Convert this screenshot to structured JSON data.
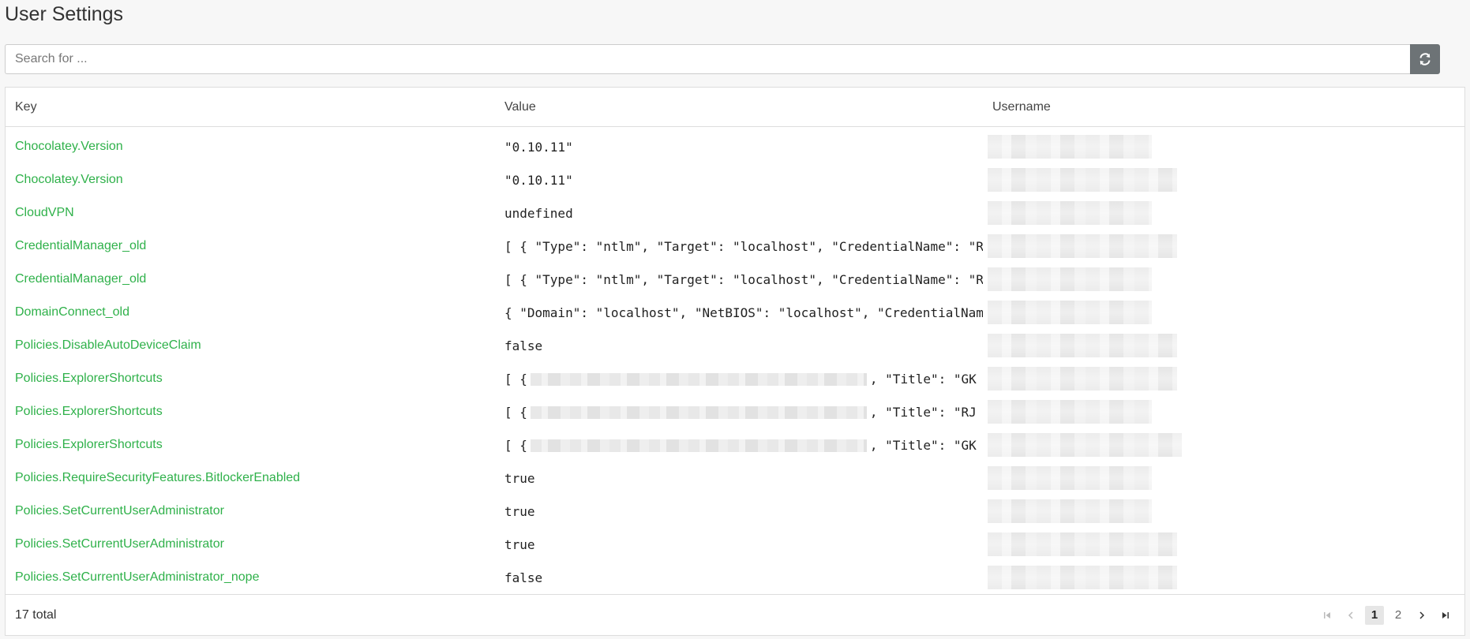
{
  "page": {
    "title": "User Settings"
  },
  "search": {
    "placeholder": "Search for ..."
  },
  "toolbar": {
    "refresh_icon": "refresh-icon"
  },
  "table": {
    "columns": [
      "Key",
      "Value",
      "Username"
    ],
    "rows": [
      {
        "key": "Chocolatey.Version",
        "value": "\"0.10.11\"",
        "value_suffix": ""
      },
      {
        "key": "Chocolatey.Version",
        "value": "\"0.10.11\"",
        "value_suffix": ""
      },
      {
        "key": "CloudVPN",
        "value": "undefined",
        "value_suffix": ""
      },
      {
        "key": "CredentialManager_old",
        "value": "[ { \"Type\": \"ntlm\", \"Target\": \"localhost\", \"CredentialName\": \"R",
        "value_suffix": ""
      },
      {
        "key": "CredentialManager_old",
        "value": "[ { \"Type\": \"ntlm\", \"Target\": \"localhost\", \"CredentialName\": \"R",
        "value_suffix": ""
      },
      {
        "key": "DomainConnect_old",
        "value": "{ \"Domain\": \"localhost\", \"NetBIOS\": \"localhost\", \"CredentialNam",
        "value_suffix": ""
      },
      {
        "key": "Policies.DisableAutoDeviceClaim",
        "value": "false",
        "value_suffix": ""
      },
      {
        "key": "Policies.ExplorerShortcuts",
        "value": "[ {",
        "value_suffix": ", \"Title\": \"GK"
      },
      {
        "key": "Policies.ExplorerShortcuts",
        "value": "[ {",
        "value_suffix": ", \"Title\": \"RJ"
      },
      {
        "key": "Policies.ExplorerShortcuts",
        "value": "[ {",
        "value_suffix": ", \"Title\": \"GK"
      },
      {
        "key": "Policies.RequireSecurityFeatures.BitlockerEnabled",
        "value": "true",
        "value_suffix": ""
      },
      {
        "key": "Policies.SetCurrentUserAdministrator",
        "value": "true",
        "value_suffix": ""
      },
      {
        "key": "Policies.SetCurrentUserAdministrator",
        "value": "true",
        "value_suffix": ""
      },
      {
        "key": "Policies.SetCurrentUserAdministrator_nope",
        "value": "false",
        "value_suffix": ""
      }
    ]
  },
  "footer": {
    "total": "17 total",
    "pages": [
      "1",
      "2"
    ],
    "current_page": "1"
  },
  "colors": {
    "link": "#2fb14a",
    "refresh_button": "#6d7376"
  }
}
